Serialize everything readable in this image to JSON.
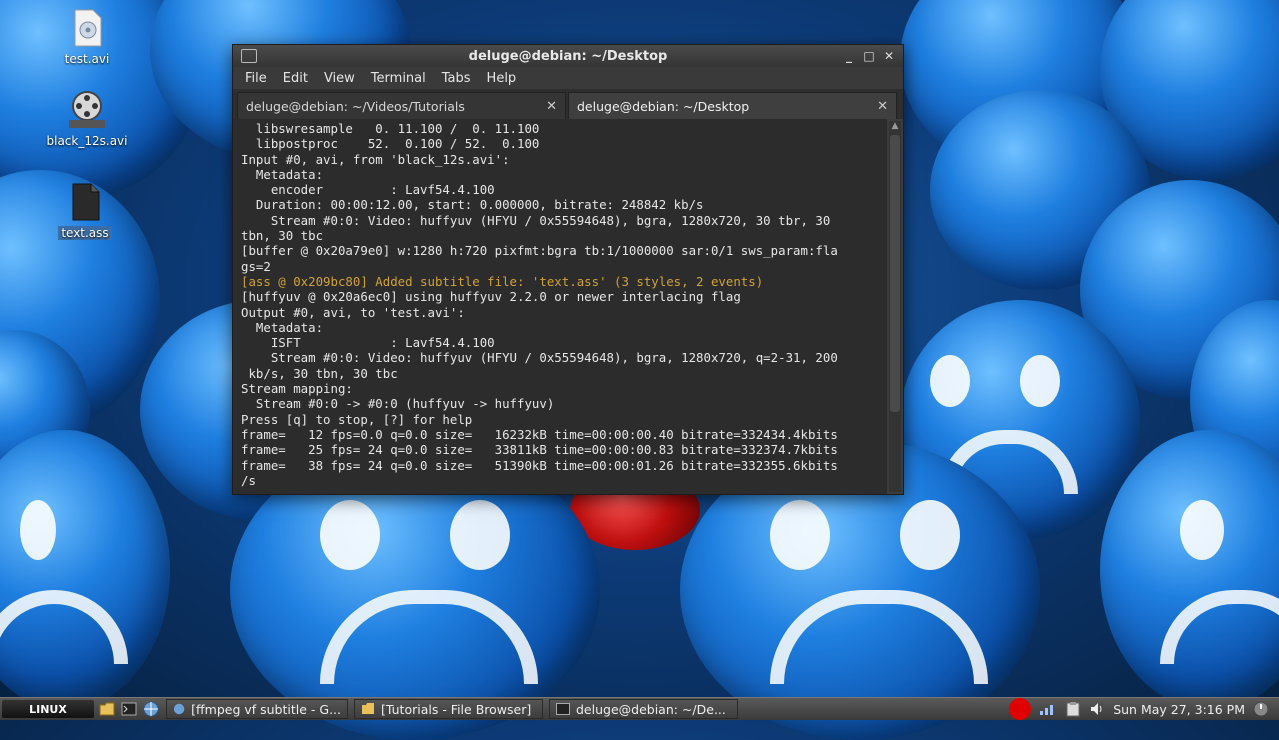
{
  "desktop": {
    "icons": [
      {
        "label": "test.avi",
        "icon": "video-file-icon"
      },
      {
        "label": "black_12s.avi",
        "icon": "film-reel-icon"
      },
      {
        "label": "text.ass",
        "icon": "text-file-icon"
      }
    ]
  },
  "window": {
    "title": "deluge@debian: ~/Desktop",
    "controls": [
      "_",
      "□",
      "✕"
    ],
    "menu": [
      "File",
      "Edit",
      "View",
      "Terminal",
      "Tabs",
      "Help"
    ],
    "tabs": [
      {
        "label": "deluge@debian: ~/Videos/Tutorials",
        "close": "✕"
      },
      {
        "label": "deluge@debian: ~/Desktop",
        "close": "✕"
      }
    ],
    "terminal_lines": [
      "  libswresample   0. 11.100 /  0. 11.100",
      "  libpostproc    52.  0.100 / 52.  0.100",
      "Input #0, avi, from 'black_12s.avi':",
      "  Metadata:",
      "    encoder         : Lavf54.4.100",
      "  Duration: 00:00:12.00, start: 0.000000, bitrate: 248842 kb/s",
      "    Stream #0:0: Video: huffyuv (HFYU / 0x55594648), bgra, 1280x720, 30 tbr, 30",
      "tbn, 30 tbc",
      "[buffer @ 0x20a79e0] w:1280 h:720 pixfmt:bgra tb:1/1000000 sar:0/1 sws_param:fla",
      "gs=2",
      "[ass @ 0x209bc80] Added subtitle file: 'text.ass' (3 styles, 2 events)",
      "[huffyuv @ 0x20a6ec0] using huffyuv 2.2.0 or newer interlacing flag",
      "Output #0, avi, to 'test.avi':",
      "  Metadata:",
      "    ISFT            : Lavf54.4.100",
      "    Stream #0:0: Video: huffyuv (HFYU / 0x55594648), bgra, 1280x720, q=2-31, 200",
      " kb/s, 30 tbn, 30 tbc",
      "Stream mapping:",
      "  Stream #0:0 -> #0:0 (huffyuv -> huffyuv)",
      "Press [q] to stop, [?] for help",
      "frame=   12 fps=0.0 q=0.0 size=   16232kB time=00:00:00.40 bitrate=332434.4kbits",
      "frame=   25 fps= 24 q=0.0 size=   33811kB time=00:00:00.83 bitrate=332374.7kbits",
      "frame=   38 fps= 24 q=0.0 size=   51390kB time=00:00:01.26 bitrate=332355.6kbits",
      "/s"
    ],
    "highlight_color": "#d2a233"
  },
  "taskbar": {
    "start_label": "LINUX",
    "tasks": [
      {
        "label": "[ffmpeg vf subtitle - G..."
      },
      {
        "label": "[Tutorials - File Browser]"
      },
      {
        "label": "deluge@debian: ~/De..."
      }
    ],
    "clock": "Sun May 27,  3:16 PM"
  }
}
